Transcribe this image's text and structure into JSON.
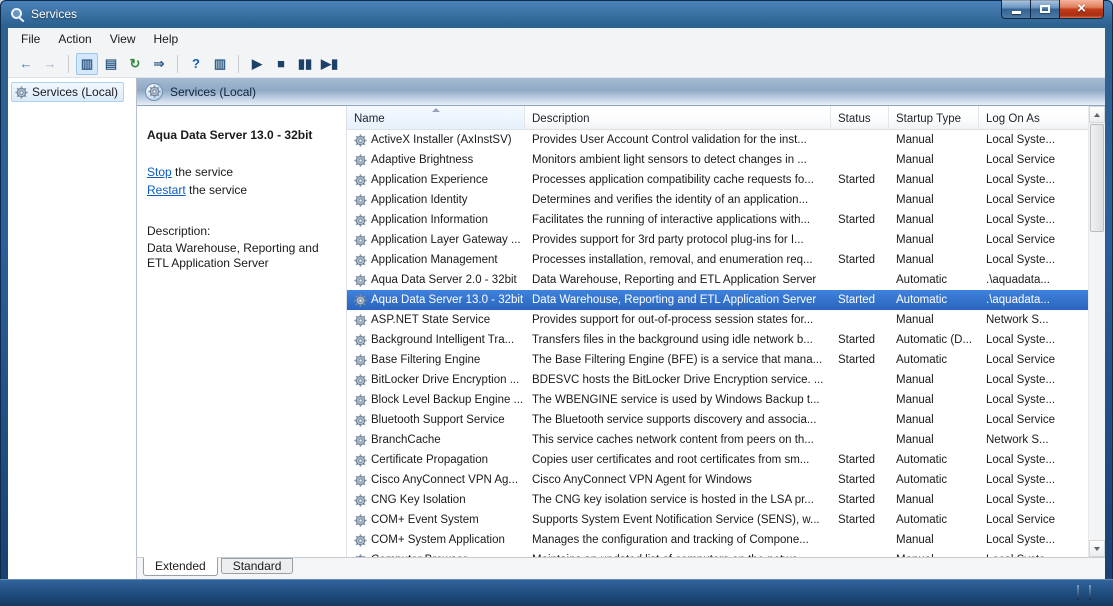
{
  "window": {
    "title": "Services",
    "close_glyph": "×"
  },
  "menubar": [
    "File",
    "Action",
    "View",
    "Help"
  ],
  "toolbar": [
    {
      "name": "back",
      "glyph": "←",
      "color": "#3f74ad"
    },
    {
      "name": "forward",
      "glyph": "→",
      "color": "#9fb4c8"
    },
    {
      "sep": true
    },
    {
      "name": "show-console-tree",
      "glyph": "▥",
      "color": "#35618c",
      "pressed": true
    },
    {
      "name": "properties",
      "glyph": "▤",
      "color": "#35618c"
    },
    {
      "name": "refresh",
      "glyph": "↻",
      "color": "#2e8b3a"
    },
    {
      "name": "export-list",
      "glyph": "⇒",
      "color": "#35618c"
    },
    {
      "sep": true
    },
    {
      "name": "help",
      "glyph": "?",
      "color": "#1a5fb4"
    },
    {
      "name": "show-action-pane",
      "glyph": "▥",
      "color": "#35618c"
    },
    {
      "sep": true
    },
    {
      "name": "start-service",
      "glyph": "▶",
      "color": "#1d4166"
    },
    {
      "name": "stop-service",
      "glyph": "■",
      "color": "#1d4166"
    },
    {
      "name": "pause-service",
      "glyph": "▮▮",
      "color": "#1d4166"
    },
    {
      "name": "restart-service",
      "glyph": "▶▮",
      "color": "#1d4166"
    }
  ],
  "sidebar": {
    "root_label": "Services (Local)"
  },
  "main": {
    "header_title": "Services (Local)"
  },
  "detail": {
    "title": "Aqua Data Server 13.0 - 32bit",
    "stop_link": "Stop",
    "stop_suffix": " the service",
    "restart_link": "Restart",
    "restart_suffix": " the service",
    "description_label": "Description:",
    "description": "Data Warehouse, Reporting and ETL Application Server"
  },
  "services": {
    "columns": [
      "Name",
      "Description",
      "Status",
      "Startup Type",
      "Log On As"
    ],
    "rows": [
      {
        "name": "ActiveX Installer (AxInstSV)",
        "description": "Provides User Account Control validation for the inst...",
        "status": "",
        "startup": "Manual",
        "logon": "Local Syste..."
      },
      {
        "name": "Adaptive Brightness",
        "description": "Monitors ambient light sensors to detect changes in ...",
        "status": "",
        "startup": "Manual",
        "logon": "Local Service"
      },
      {
        "name": "Application Experience",
        "description": "Processes application compatibility cache requests fo...",
        "status": "Started",
        "startup": "Manual",
        "logon": "Local Syste..."
      },
      {
        "name": "Application Identity",
        "description": "Determines and verifies the identity of an application...",
        "status": "",
        "startup": "Manual",
        "logon": "Local Service"
      },
      {
        "name": "Application Information",
        "description": "Facilitates the running of interactive applications with...",
        "status": "Started",
        "startup": "Manual",
        "logon": "Local Syste..."
      },
      {
        "name": "Application Layer Gateway ...",
        "description": "Provides support for 3rd party protocol plug-ins for I...",
        "status": "",
        "startup": "Manual",
        "logon": "Local Service"
      },
      {
        "name": "Application Management",
        "description": "Processes installation, removal, and enumeration req...",
        "status": "Started",
        "startup": "Manual",
        "logon": "Local Syste..."
      },
      {
        "name": "Aqua Data Server 2.0 - 32bit",
        "description": "Data Warehouse, Reporting and ETL Application Server",
        "status": "",
        "startup": "Automatic",
        "logon": ".\\aquadata..."
      },
      {
        "name": "Aqua Data Server 13.0 - 32bit",
        "description": "Data Warehouse, Reporting and ETL Application Server",
        "status": "Started",
        "startup": "Automatic",
        "logon": ".\\aquadata...",
        "selected": true
      },
      {
        "name": "ASP.NET State Service",
        "description": "Provides support for out-of-process session states for...",
        "status": "",
        "startup": "Manual",
        "logon": "Network S..."
      },
      {
        "name": "Background Intelligent Tra...",
        "description": "Transfers files in the background using idle network b...",
        "status": "Started",
        "startup": "Automatic (D...",
        "logon": "Local Syste..."
      },
      {
        "name": "Base Filtering Engine",
        "description": "The Base Filtering Engine (BFE) is a service that mana...",
        "status": "Started",
        "startup": "Automatic",
        "logon": "Local Service"
      },
      {
        "name": "BitLocker Drive Encryption ...",
        "description": "BDESVC hosts the BitLocker Drive Encryption service. ...",
        "status": "",
        "startup": "Manual",
        "logon": "Local Syste..."
      },
      {
        "name": "Block Level Backup Engine ...",
        "description": "The WBENGINE service is used by Windows Backup t...",
        "status": "",
        "startup": "Manual",
        "logon": "Local Syste..."
      },
      {
        "name": "Bluetooth Support Service",
        "description": "The Bluetooth service supports discovery and associa...",
        "status": "",
        "startup": "Manual",
        "logon": "Local Service"
      },
      {
        "name": "BranchCache",
        "description": "This service caches network content from peers on th...",
        "status": "",
        "startup": "Manual",
        "logon": "Network S..."
      },
      {
        "name": "Certificate Propagation",
        "description": "Copies user certificates and root certificates from sm...",
        "status": "Started",
        "startup": "Automatic",
        "logon": "Local Syste..."
      },
      {
        "name": "Cisco AnyConnect VPN Ag...",
        "description": "Cisco AnyConnect VPN Agent for Windows",
        "status": "Started",
        "startup": "Automatic",
        "logon": "Local Syste..."
      },
      {
        "name": "CNG Key Isolation",
        "description": "The CNG key isolation service is hosted in the LSA pr...",
        "status": "Started",
        "startup": "Manual",
        "logon": "Local Syste..."
      },
      {
        "name": "COM+ Event System",
        "description": "Supports System Event Notification Service (SENS), w...",
        "status": "Started",
        "startup": "Automatic",
        "logon": "Local Service"
      },
      {
        "name": "COM+ System Application",
        "description": "Manages the configuration and tracking of Compone...",
        "status": "",
        "startup": "Manual",
        "logon": "Local Syste..."
      },
      {
        "name": "Computer Browser",
        "description": "Maintains an updated list of computers on the netwo...",
        "status": "",
        "startup": "Manual",
        "logon": "Local Syste..."
      }
    ]
  },
  "tabs": [
    {
      "label": "Extended"
    },
    {
      "label": "Standard"
    }
  ],
  "colors": {
    "selection": "#2f6fc7",
    "link": "#0b5cc4",
    "titlebar": "#1f4f87"
  }
}
